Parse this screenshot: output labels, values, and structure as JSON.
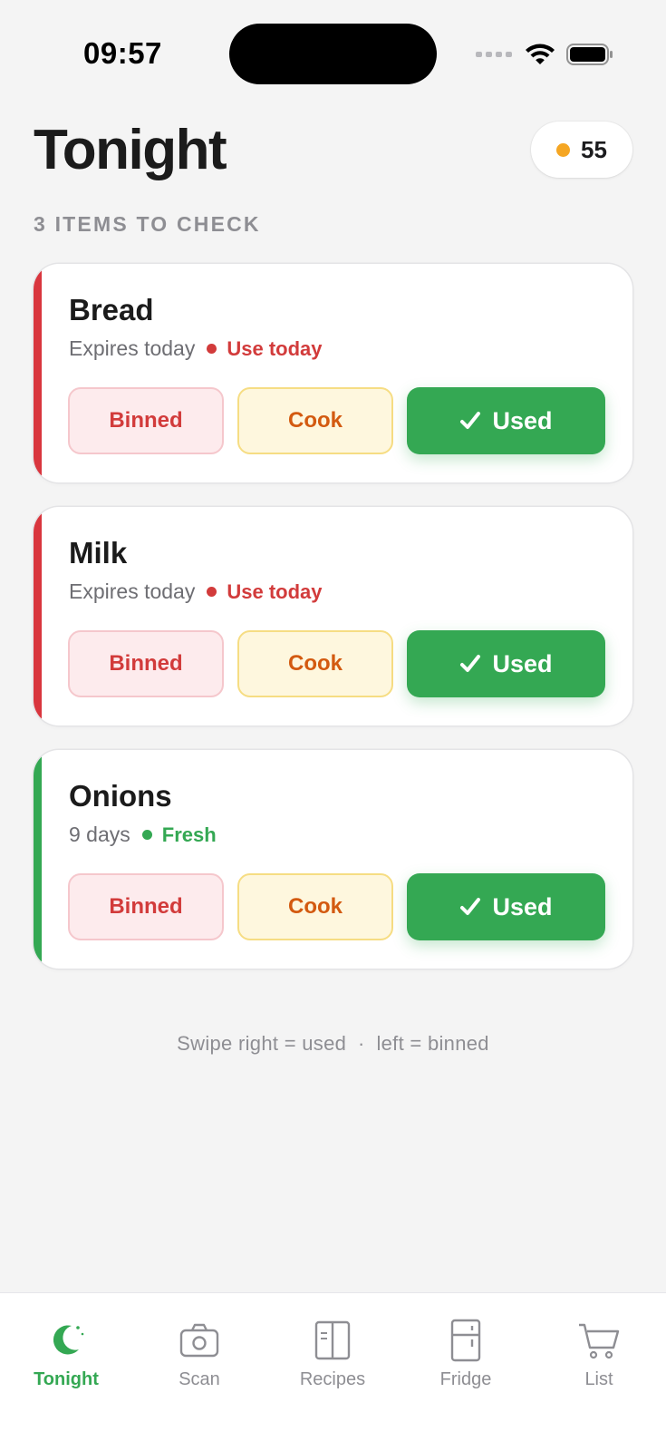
{
  "status_bar": {
    "time": "09:57"
  },
  "header": {
    "title": "Tonight",
    "points": "55",
    "coin_color": "#f5a623"
  },
  "section_label": "3 ITEMS TO CHECK",
  "items": [
    {
      "name": "Bread",
      "expiry": "Expires today",
      "status": "Use today",
      "status_color": "#d23b3b",
      "accent_color": "#d9363e"
    },
    {
      "name": "Milk",
      "expiry": "Expires today",
      "status": "Use today",
      "status_color": "#d23b3b",
      "accent_color": "#d9363e"
    },
    {
      "name": "Onions",
      "expiry": "9 days",
      "status": "Fresh",
      "status_color": "#34a853",
      "accent_color": "#34a853"
    }
  ],
  "actions": {
    "binned": "Binned",
    "cook": "Cook",
    "used": "Used"
  },
  "hint": "Swipe right = used  ·  left = binned",
  "tabbar": {
    "active": "Tonight",
    "tabs": [
      {
        "label": "Tonight",
        "icon": "moon-icon"
      },
      {
        "label": "Scan",
        "icon": "camera-icon"
      },
      {
        "label": "Recipes",
        "icon": "book-icon"
      },
      {
        "label": "Fridge",
        "icon": "fridge-icon"
      },
      {
        "label": "List",
        "icon": "cart-icon"
      }
    ]
  },
  "colors": {
    "accent": "#34a853",
    "danger": "#d23b3b",
    "background": "#f4f4f4"
  }
}
